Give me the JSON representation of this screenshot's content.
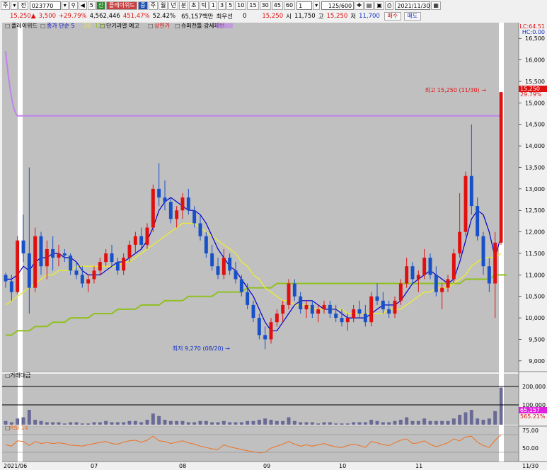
{
  "toolbar": {
    "market_select": "주",
    "type_select": "전",
    "code_input": "023770",
    "search_icon": "magnifier-icon",
    "sound_icon": "speaker-icon",
    "sound_count": "5",
    "new_badge": "신",
    "stock_name": "플레이위드",
    "mode_badge": "중",
    "period_buttons": [
      "주",
      "월",
      "년",
      "분",
      "초",
      "틱"
    ],
    "interval_buttons": [
      "1",
      "3",
      "5",
      "10",
      "15",
      "30",
      "45",
      "60"
    ],
    "interval_input": "1",
    "count_input": "125/600",
    "date_input": "2021/11/30",
    "icons": [
      "overlay-icon",
      "chart-icon",
      "save-icon",
      "print-icon"
    ]
  },
  "quote": {
    "price": "15,250",
    "change": "3,500",
    "change_pct": "+29.79%",
    "volume": "4,562,446",
    "volume_ratio": "451.47%",
    "turnover": "52.42%",
    "amount": "65,157백만",
    "priority_label": "최우선",
    "priority_value": "0",
    "current": "15,250",
    "open_label": "시",
    "open": "11,750",
    "high_label": "고",
    "high": "15,250",
    "low_label": "저",
    "low": "11,700",
    "buy_label": "매수",
    "sell_label": "매도"
  },
  "colors": {
    "up": "#e01010",
    "down": "#1850c8",
    "ma5": "#0000cc",
    "ma20": "#e8e840",
    "ma120": "#90c020",
    "upper_limit": "#c080f0",
    "volume": "#6a6a96",
    "rsi": "#f07020"
  },
  "chart_data": {
    "type": "candlestick",
    "stock": "플레이위드",
    "legend": [
      {
        "label": "플레이위드",
        "color": "#000000"
      },
      {
        "label": "종가 단순 5",
        "color": "#0000cc"
      },
      {
        "label": "20",
        "color": "#e8e840"
      },
      {
        "label": "120",
        "color": "#90c020"
      },
      {
        "label": "단기과열 예고",
        "color": "#000000"
      },
      {
        "label": "상한가",
        "color": "#e01010"
      },
      {
        "label": "슈퍼천틀 강세패턴",
        "color": "#000000"
      },
      {
        "label": "",
        "color": "#c080f0"
      }
    ],
    "price_axis_ticks": [
      9000,
      9500,
      10000,
      10500,
      11000,
      11500,
      12000,
      12500,
      13000,
      13500,
      14000,
      14500,
      15000,
      15500,
      16000,
      16500
    ],
    "ylim": [
      8800,
      16800
    ],
    "y_unit_hint": "",
    "lc_label": "LC:64.51",
    "hc_label": "HC:0.00",
    "current_price_label": "15,250",
    "current_pct_label": "29.79%",
    "max_annotation": "최고 15,250 (11/30) →",
    "min_annotation": "최저 9,270 (08/20) →",
    "x_ticks": [
      "2021/06",
      "07",
      "08",
      "09",
      "10",
      "11",
      "11/30"
    ],
    "volume_panel": {
      "label": "거래대금",
      "ticks": [
        "200,000",
        "100,000"
      ],
      "value_label": "65,157",
      "pct_label": "565.21%"
    },
    "rsi_panel": {
      "label": "RSI 14",
      "ticks": [
        "75.00",
        "50.00"
      ]
    },
    "candles": [
      [
        11.0,
        11.05,
        10.7,
        10.85
      ],
      [
        10.85,
        11.0,
        10.4,
        10.6
      ],
      [
        10.6,
        11.9,
        10.55,
        11.8
      ],
      [
        11.8,
        12.4,
        11.3,
        11.5
      ],
      [
        11.5,
        13.5,
        10.1,
        10.7
      ],
      [
        10.7,
        12.1,
        10.6,
        11.9
      ],
      [
        11.9,
        12.0,
        11.0,
        11.2
      ],
      [
        11.2,
        11.8,
        10.9,
        11.6
      ],
      [
        11.6,
        11.9,
        11.1,
        11.4
      ],
      [
        11.4,
        11.7,
        11.2,
        11.5
      ],
      [
        11.5,
        11.6,
        11.3,
        11.45
      ],
      [
        11.45,
        11.5,
        11.0,
        11.1
      ],
      [
        11.1,
        11.3,
        10.9,
        11.0
      ],
      [
        11.0,
        11.2,
        10.7,
        10.8
      ],
      [
        10.8,
        11.0,
        10.6,
        10.9
      ],
      [
        10.9,
        11.2,
        10.8,
        11.1
      ],
      [
        11.1,
        11.4,
        11.0,
        11.3
      ],
      [
        11.3,
        11.6,
        11.2,
        11.5
      ],
      [
        11.5,
        11.7,
        11.2,
        11.3
      ],
      [
        11.3,
        11.4,
        11.0,
        11.1
      ],
      [
        11.1,
        11.5,
        11.0,
        11.4
      ],
      [
        11.4,
        11.8,
        11.3,
        11.7
      ],
      [
        11.7,
        12.0,
        11.5,
        11.9
      ],
      [
        11.9,
        12.1,
        11.6,
        11.7
      ],
      [
        11.7,
        12.2,
        11.6,
        12.1
      ],
      [
        12.1,
        13.1,
        12.0,
        13.0
      ],
      [
        13.0,
        13.6,
        12.6,
        12.8
      ],
      [
        12.8,
        13.2,
        12.5,
        12.7
      ],
      [
        12.7,
        12.8,
        12.2,
        12.3
      ],
      [
        12.3,
        12.6,
        12.1,
        12.5
      ],
      [
        12.5,
        12.9,
        12.3,
        12.8
      ],
      [
        12.8,
        13.0,
        12.4,
        12.5
      ],
      [
        12.5,
        12.6,
        12.1,
        12.2
      ],
      [
        12.2,
        12.4,
        11.8,
        11.9
      ],
      [
        11.9,
        12.0,
        11.4,
        11.5
      ],
      [
        11.5,
        11.7,
        11.1,
        11.2
      ],
      [
        11.2,
        11.4,
        10.9,
        11.0
      ],
      [
        11.0,
        11.6,
        10.9,
        11.4
      ],
      [
        11.4,
        11.5,
        11.0,
        11.1
      ],
      [
        11.1,
        11.3,
        10.8,
        10.9
      ],
      [
        10.9,
        11.0,
        10.5,
        10.6
      ],
      [
        10.6,
        10.8,
        10.2,
        10.3
      ],
      [
        10.3,
        10.4,
        9.9,
        10.0
      ],
      [
        10.0,
        10.1,
        9.5,
        9.6
      ],
      [
        9.6,
        9.8,
        9.27,
        9.5
      ],
      [
        9.5,
        10.0,
        9.4,
        9.9
      ],
      [
        9.9,
        10.2,
        9.8,
        10.1
      ],
      [
        10.1,
        10.4,
        9.9,
        10.3
      ],
      [
        10.3,
        10.9,
        10.2,
        10.8
      ],
      [
        10.8,
        10.9,
        10.4,
        10.5
      ],
      [
        10.5,
        10.6,
        10.1,
        10.2
      ],
      [
        10.2,
        10.4,
        10.0,
        10.3
      ],
      [
        10.3,
        10.4,
        10.0,
        10.1
      ],
      [
        10.1,
        10.3,
        9.9,
        10.2
      ],
      [
        10.2,
        10.4,
        10.1,
        10.3
      ],
      [
        10.3,
        10.4,
        10.0,
        10.1
      ],
      [
        10.1,
        10.3,
        9.9,
        10.0
      ],
      [
        10.0,
        10.2,
        9.8,
        9.9
      ],
      [
        9.9,
        10.1,
        9.7,
        10.0
      ],
      [
        10.0,
        10.3,
        9.9,
        10.2
      ],
      [
        10.2,
        10.4,
        10.0,
        10.1
      ],
      [
        10.1,
        10.3,
        9.8,
        9.9
      ],
      [
        9.9,
        10.6,
        9.8,
        10.5
      ],
      [
        10.5,
        10.8,
        10.3,
        10.4
      ],
      [
        10.4,
        10.6,
        10.1,
        10.2
      ],
      [
        10.2,
        10.4,
        10.0,
        10.1
      ],
      [
        10.1,
        10.5,
        10.0,
        10.4
      ],
      [
        10.4,
        10.9,
        10.3,
        10.8
      ],
      [
        10.8,
        11.4,
        10.7,
        11.2
      ],
      [
        11.2,
        11.3,
        10.8,
        10.9
      ],
      [
        10.9,
        11.1,
        10.6,
        11.0
      ],
      [
        11.0,
        11.6,
        10.9,
        11.4
      ],
      [
        11.4,
        11.5,
        10.9,
        11.0
      ],
      [
        11.0,
        11.2,
        10.5,
        10.6
      ],
      [
        10.6,
        10.8,
        10.2,
        10.7
      ],
      [
        10.7,
        11.0,
        10.6,
        10.9
      ],
      [
        10.9,
        11.6,
        10.8,
        11.5
      ],
      [
        11.5,
        12.9,
        11.4,
        12.0
      ],
      [
        12.0,
        13.4,
        11.9,
        13.3
      ],
      [
        13.3,
        14.5,
        12.4,
        12.6
      ],
      [
        12.6,
        12.8,
        11.8,
        11.9
      ],
      [
        11.9,
        12.0,
        11.0,
        11.2
      ],
      [
        11.2,
        11.4,
        10.6,
        10.8
      ],
      [
        10.8,
        12.0,
        10.0,
        11.75
      ],
      [
        11.75,
        15.25,
        11.7,
        15.25
      ]
    ],
    "ma5": [
      10.9,
      10.9,
      11.0,
      11.2,
      11.1,
      11.3,
      11.4,
      11.4,
      11.5,
      11.5,
      11.4,
      11.4,
      11.3,
      11.1,
      11.0,
      11.0,
      11.0,
      11.1,
      11.2,
      11.3,
      11.3,
      11.4,
      11.5,
      11.6,
      11.8,
      12.1,
      12.5,
      12.7,
      12.8,
      12.7,
      12.6,
      12.5,
      12.5,
      12.4,
      12.2,
      11.9,
      11.6,
      11.4,
      11.2,
      11.1,
      10.9,
      10.7,
      10.5,
      10.2,
      9.9,
      9.7,
      9.7,
      9.9,
      10.1,
      10.3,
      10.4,
      10.4,
      10.4,
      10.3,
      10.2,
      10.2,
      10.2,
      10.1,
      10.0,
      10.0,
      10.0,
      10.0,
      10.1,
      10.2,
      10.3,
      10.3,
      10.3,
      10.4,
      10.6,
      10.8,
      10.9,
      11.0,
      11.1,
      11.0,
      10.9,
      10.8,
      10.9,
      11.3,
      11.8,
      12.3,
      12.5,
      12.4,
      12.0,
      11.4,
      11.9
    ],
    "ma20": [
      10.3,
      10.4,
      10.5,
      10.6,
      10.7,
      10.8,
      10.9,
      11.0,
      11.0,
      11.1,
      11.1,
      11.1,
      11.2,
      11.2,
      11.2,
      11.2,
      11.2,
      11.2,
      11.2,
      11.2,
      11.3,
      11.3,
      11.4,
      11.5,
      11.6,
      11.7,
      11.8,
      11.9,
      12.0,
      12.1,
      12.2,
      12.2,
      12.2,
      12.1,
      12.0,
      11.9,
      11.8,
      11.7,
      11.6,
      11.5,
      11.3,
      11.2,
      11.0,
      10.9,
      10.7,
      10.6,
      10.5,
      10.4,
      10.4,
      10.3,
      10.3,
      10.3,
      10.2,
      10.2,
      10.2,
      10.2,
      10.2,
      10.2,
      10.1,
      10.1,
      10.1,
      10.1,
      10.1,
      10.1,
      10.1,
      10.2,
      10.2,
      10.2,
      10.3,
      10.4,
      10.5,
      10.6,
      10.6,
      10.7,
      10.7,
      10.7,
      10.8,
      10.9,
      11.0,
      11.2,
      11.3,
      11.4,
      11.4,
      11.4,
      11.5
    ],
    "ma120": [
      9.6,
      9.6,
      9.7,
      9.7,
      9.7,
      9.8,
      9.8,
      9.8,
      9.9,
      9.9,
      9.9,
      10.0,
      10.0,
      10.0,
      10.0,
      10.1,
      10.1,
      10.1,
      10.1,
      10.2,
      10.2,
      10.2,
      10.2,
      10.3,
      10.3,
      10.3,
      10.3,
      10.4,
      10.4,
      10.4,
      10.4,
      10.5,
      10.5,
      10.5,
      10.5,
      10.5,
      10.6,
      10.6,
      10.6,
      10.6,
      10.6,
      10.7,
      10.7,
      10.7,
      10.7,
      10.7,
      10.8,
      10.8,
      10.8,
      10.8,
      10.8,
      10.8,
      10.8,
      10.8,
      10.8,
      10.8,
      10.8,
      10.8,
      10.8,
      10.8,
      10.8,
      10.8,
      10.8,
      10.8,
      10.8,
      10.8,
      10.8,
      10.8,
      10.8,
      10.8,
      10.8,
      10.8,
      10.8,
      10.8,
      10.8,
      10.8,
      10.8,
      10.8,
      10.9,
      10.9,
      10.9,
      10.9,
      10.9,
      11.0,
      11.0,
      11.0
    ],
    "volume": [
      3,
      2,
      5,
      6,
      12,
      4,
      3,
      2,
      2,
      2,
      1,
      2,
      2,
      1,
      1,
      2,
      2,
      3,
      2,
      2,
      2,
      3,
      3,
      2,
      4,
      9,
      7,
      4,
      3,
      3,
      3,
      2,
      2,
      3,
      3,
      2,
      2,
      3,
      2,
      2,
      2,
      3,
      3,
      4,
      5,
      4,
      3,
      3,
      6,
      3,
      2,
      2,
      2,
      1,
      2,
      2,
      1,
      1,
      1,
      2,
      2,
      2,
      4,
      3,
      2,
      2,
      3,
      4,
      6,
      3,
      3,
      5,
      3,
      3,
      3,
      3,
      5,
      8,
      10,
      12,
      5,
      4,
      5,
      11,
      30
    ],
    "rsi": [
      48,
      44,
      60,
      58,
      46,
      58,
      52,
      55,
      52,
      54,
      52,
      47,
      46,
      44,
      48,
      52,
      55,
      58,
      52,
      50,
      56,
      60,
      62,
      56,
      62,
      74,
      60,
      58,
      52,
      56,
      60,
      54,
      50,
      44,
      40,
      36,
      34,
      48,
      42,
      38,
      34,
      30,
      27,
      24,
      26,
      38,
      44,
      50,
      58,
      50,
      44,
      48,
      44,
      48,
      52,
      46,
      42,
      40,
      46,
      50,
      46,
      40,
      58,
      54,
      48,
      46,
      54,
      62,
      66,
      52,
      54,
      60,
      50,
      42,
      48,
      54,
      66,
      60,
      72,
      74,
      56,
      46,
      40,
      62,
      78
    ]
  }
}
